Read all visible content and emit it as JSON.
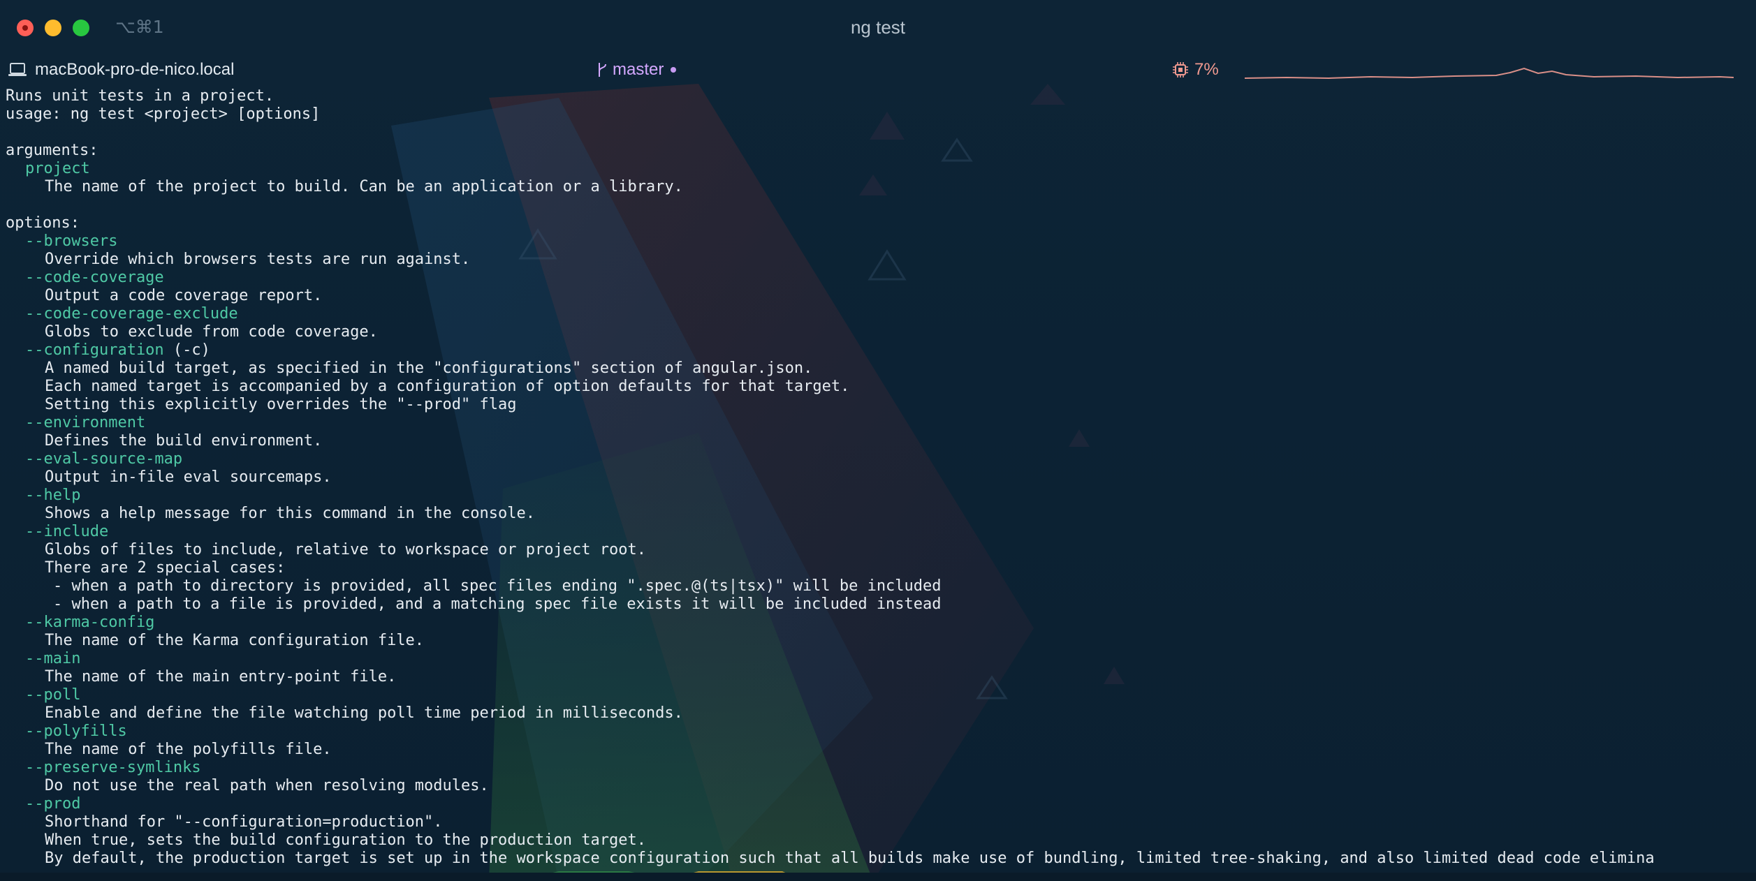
{
  "window": {
    "title": "ng test",
    "shortcut": "⌥⌘1"
  },
  "statusbar": {
    "host": "macBook-pro-de-nico.local",
    "branch": "master",
    "cpu": "7%"
  },
  "terminal": {
    "intro": [
      "Runs unit tests in a project.",
      "usage: ng test <project> [options]",
      "",
      "arguments:"
    ],
    "argument": {
      "name": "project",
      "desc": "The name of the project to build. Can be an application or a library."
    },
    "options_header": "options:",
    "options": [
      {
        "flag": "--browsers",
        "alias": "",
        "desc": [
          "Override which browsers tests are run against."
        ]
      },
      {
        "flag": "--code-coverage",
        "alias": "",
        "desc": [
          "Output a code coverage report."
        ]
      },
      {
        "flag": "--code-coverage-exclude",
        "alias": "",
        "desc": [
          "Globs to exclude from code coverage."
        ]
      },
      {
        "flag": "--configuration",
        "alias": " (-c)",
        "desc": [
          "A named build target, as specified in the \"configurations\" section of angular.json.",
          "Each named target is accompanied by a configuration of option defaults for that target.",
          "Setting this explicitly overrides the \"--prod\" flag"
        ]
      },
      {
        "flag": "--environment",
        "alias": "",
        "desc": [
          "Defines the build environment."
        ]
      },
      {
        "flag": "--eval-source-map",
        "alias": "",
        "desc": [
          "Output in-file eval sourcemaps."
        ]
      },
      {
        "flag": "--help",
        "alias": "",
        "desc": [
          "Shows a help message for this command in the console."
        ]
      },
      {
        "flag": "--include",
        "alias": "",
        "desc": [
          "Globs of files to include, relative to workspace or project root.",
          "There are 2 special cases:"
        ],
        "sub": [
          "- when a path to directory is provided, all spec files ending \".spec.@(ts|tsx)\" will be included",
          "- when a path to a file is provided, and a matching spec file exists it will be included instead"
        ]
      },
      {
        "flag": "--karma-config",
        "alias": "",
        "desc": [
          "The name of the Karma configuration file."
        ]
      },
      {
        "flag": "--main",
        "alias": "",
        "desc": [
          "The name of the main entry-point file."
        ]
      },
      {
        "flag": "--poll",
        "alias": "",
        "desc": [
          "Enable and define the file watching poll time period in milliseconds."
        ]
      },
      {
        "flag": "--polyfills",
        "alias": "",
        "desc": [
          "The name of the polyfills file."
        ]
      },
      {
        "flag": "--preserve-symlinks",
        "alias": "",
        "desc": [
          "Do not use the real path when resolving modules."
        ]
      },
      {
        "flag": "--prod",
        "alias": "",
        "desc": [
          "Shorthand for \"--configuration=production\".",
          "When true, sets the build configuration to the production target.",
          "By default, the production target is set up in the workspace configuration such that all builds make use of bundling, limited tree-shaking, and also limited dead code elimina"
        ]
      }
    ]
  },
  "colors": {
    "background": "#0c2233",
    "option_flag": "#4fc9a5",
    "text": "#e7ecf1",
    "branch": "#d4a8ff",
    "cpu": "#f19a90"
  },
  "icons": {
    "host": "laptop-icon",
    "branch": "git-branch-icon",
    "cpu": "cpu-chip-icon"
  }
}
